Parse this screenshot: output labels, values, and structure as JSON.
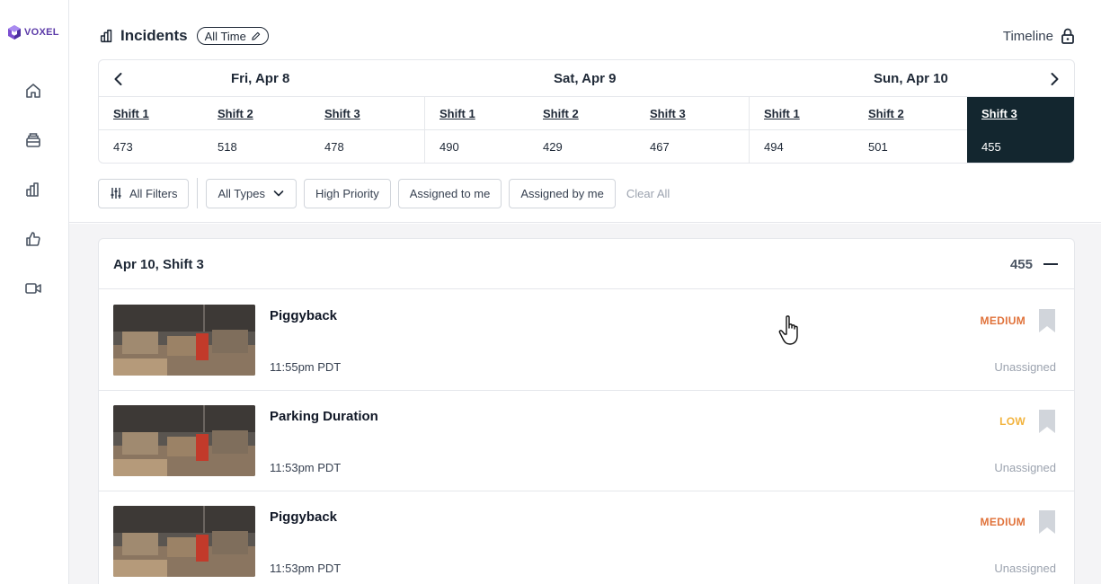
{
  "brand": {
    "name": "VOXEL"
  },
  "sidebar": {
    "items": [
      {
        "icon": "home-icon"
      },
      {
        "icon": "inbox-icon"
      },
      {
        "icon": "bar-chart-icon"
      },
      {
        "icon": "thumbs-up-icon"
      },
      {
        "icon": "video-camera-icon"
      }
    ]
  },
  "header": {
    "title": "Incidents",
    "time_filter": "All Time",
    "timeline_label": "Timeline"
  },
  "shifts": {
    "days": [
      {
        "label": "Fri, Apr 8",
        "shifts": [
          {
            "name": "Shift 1",
            "count": "473"
          },
          {
            "name": "Shift 2",
            "count": "518"
          },
          {
            "name": "Shift 3",
            "count": "478"
          }
        ]
      },
      {
        "label": "Sat, Apr 9",
        "shifts": [
          {
            "name": "Shift 1",
            "count": "490"
          },
          {
            "name": "Shift 2",
            "count": "429"
          },
          {
            "name": "Shift 3",
            "count": "467"
          }
        ]
      },
      {
        "label": "Sun, Apr 10",
        "shifts": [
          {
            "name": "Shift 1",
            "count": "494"
          },
          {
            "name": "Shift 2",
            "count": "501"
          },
          {
            "name": "Shift 3",
            "count": "455",
            "selected": true
          }
        ]
      }
    ]
  },
  "filters": {
    "all_filters": "All Filters",
    "all_types": "All Types",
    "high_priority": "High Priority",
    "assigned_to_me": "Assigned to me",
    "assigned_by_me": "Assigned by me",
    "clear_all": "Clear All"
  },
  "group": {
    "title": "Apr 10, Shift 3",
    "count": "455"
  },
  "incidents": [
    {
      "title": "Piggyback",
      "time": "11:55pm PDT",
      "priority": "MEDIUM",
      "priority_color": "#e0723a",
      "assignee": "Unassigned"
    },
    {
      "title": "Parking Duration",
      "time": "11:53pm PDT",
      "priority": "LOW",
      "priority_color": "#f2b33d",
      "assignee": "Unassigned"
    },
    {
      "title": "Piggyback",
      "time": "11:53pm PDT",
      "priority": "MEDIUM",
      "priority_color": "#e0723a",
      "assignee": "Unassigned"
    }
  ],
  "colors": {
    "selected_shift_bg": "#13262f",
    "brand_purple": "#5b3aa8"
  }
}
